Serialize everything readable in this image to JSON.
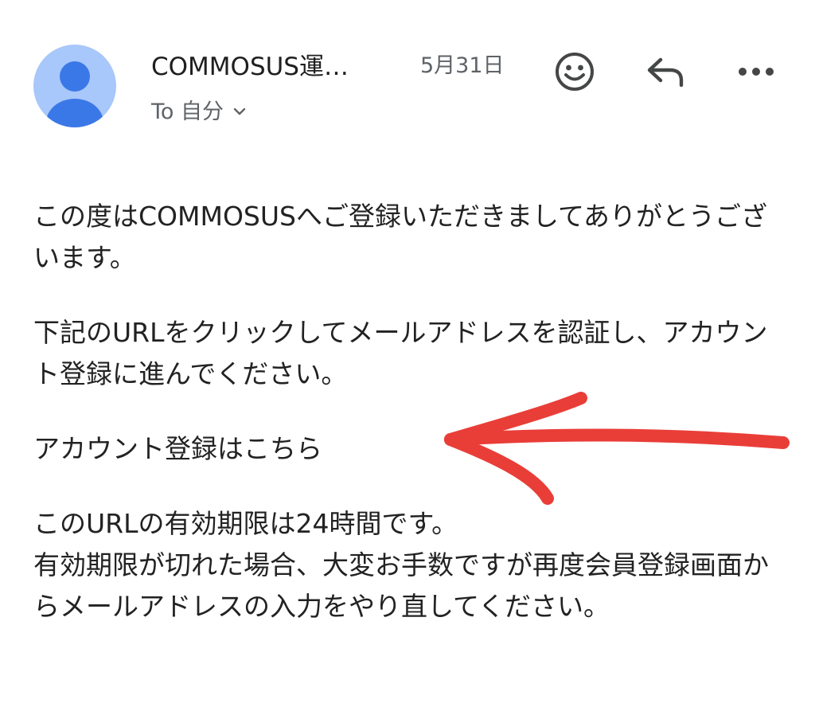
{
  "header": {
    "sender": "COMMOSUS運…",
    "date": "5月31日",
    "to_label": "To 自分",
    "icons": {
      "avatar": "person-icon",
      "emoji": "emoji-reaction-icon",
      "reply": "reply-icon",
      "more": "more-horizontal-icon",
      "chevron": "chevron-down-icon"
    }
  },
  "message": {
    "paragraph1": "この度はCOMMOSUSへご登録いただきましてありがとうございます。",
    "paragraph2": "下記のURLをクリックしてメールアドレスを認証し、アカウント登録に進んでください。",
    "link_text": "アカウント登録はこちら",
    "paragraph4_line1": "このURLの有効期限は24時間です。",
    "paragraph4_line2": "有効期限が切れた場合、大変お手数ですが再度会員登録画面からメールアドレスの入力をやり直してください。"
  },
  "colors": {
    "avatar_bg": "#a8c7fa",
    "avatar_figure": "#3b78e7",
    "annotation_red": "#e8302a",
    "secondary_text": "#5f6368"
  }
}
